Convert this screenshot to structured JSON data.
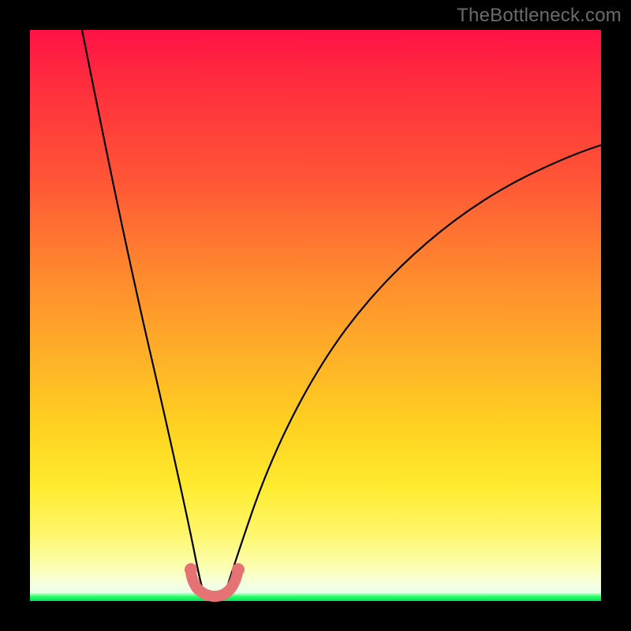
{
  "watermark": "TheBottleneck.com",
  "chart_data": {
    "type": "line",
    "title": "",
    "xlabel": "",
    "ylabel": "",
    "xlim": [
      0,
      100
    ],
    "ylim": [
      0,
      100
    ],
    "grid": false,
    "legend": false,
    "series": [
      {
        "name": "left-curve",
        "x": [
          9,
          12,
          15,
          18,
          21,
          24,
          26,
          28,
          29.5
        ],
        "y": [
          100,
          82,
          64,
          47,
          31,
          17,
          8,
          3,
          1
        ]
      },
      {
        "name": "right-curve",
        "x": [
          34,
          36,
          39,
          43,
          48,
          55,
          63,
          73,
          85,
          100
        ],
        "y": [
          1,
          4,
          11,
          21,
          33,
          45,
          56,
          65,
          73,
          80
        ]
      },
      {
        "name": "pink-minimum-band",
        "x": [
          27,
          28,
          29,
          30,
          31,
          32,
          33,
          34,
          35
        ],
        "y": [
          6,
          3,
          1.5,
          0.8,
          0.6,
          0.8,
          1.5,
          3,
          6
        ]
      }
    ],
    "annotations": [
      {
        "text": "TheBottleneck.com",
        "position": "top-right"
      }
    ]
  }
}
